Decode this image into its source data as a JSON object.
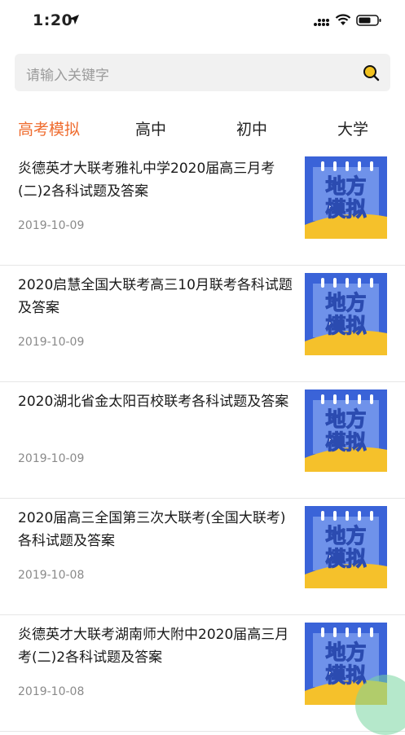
{
  "status_bar": {
    "time": "1:20"
  },
  "search": {
    "placeholder": "请输入关键字"
  },
  "tabs": [
    {
      "label": "高考模拟",
      "active": true
    },
    {
      "label": "高中",
      "active": false
    },
    {
      "label": "初中",
      "active": false
    },
    {
      "label": "大学",
      "active": false
    }
  ],
  "thumbnail": {
    "line1": "地方",
    "line2": "模拟"
  },
  "colors": {
    "accent": "#ef6c2f",
    "thumb_blue": "#3a63d8",
    "thumb_yellow": "#f5c12b"
  },
  "articles": [
    {
      "title": "炎德英才大联考雅礼中学2020届高三月考(二)2各科试题及答案",
      "date": "2019-10-09"
    },
    {
      "title": "2020启慧全国大联考高三10月联考各科试题及答案",
      "date": "2019-10-09"
    },
    {
      "title": "2020湖北省金太阳百校联考各科试题及答案",
      "date": "2019-10-09"
    },
    {
      "title": "2020届高三全国第三次大联考(全国大联考)各科试题及答案",
      "date": "2019-10-08"
    },
    {
      "title": "炎德英才大联考湖南师大附中2020届高三月考(二)2各科试题及答案",
      "date": "2019-10-08"
    }
  ]
}
